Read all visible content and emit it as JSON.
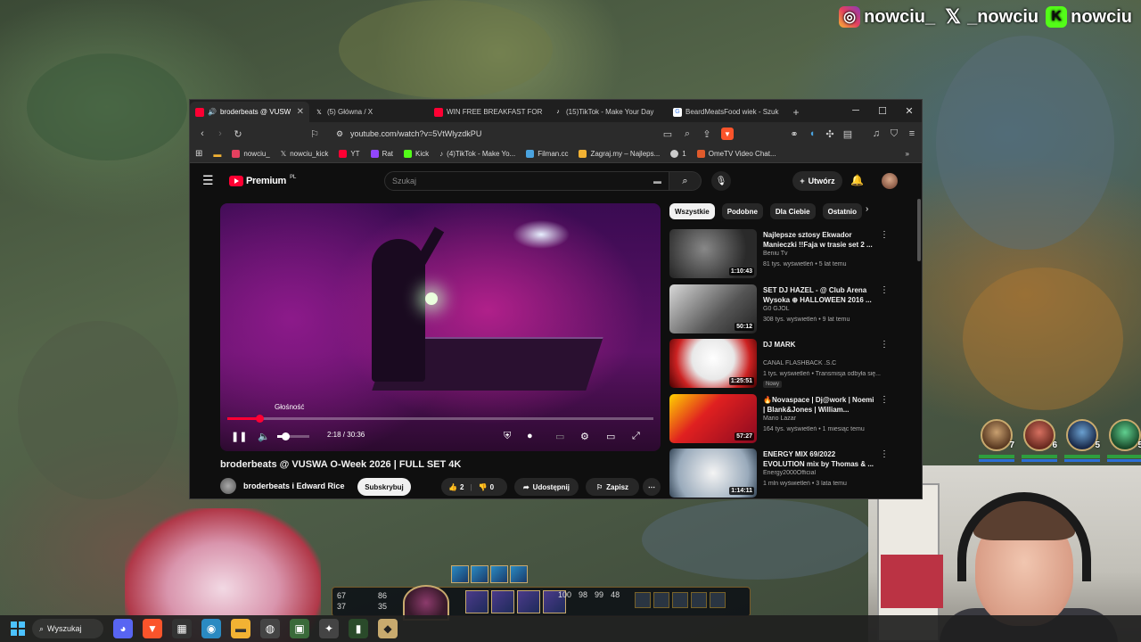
{
  "overlay": {
    "socials": [
      {
        "icon": "instagram-icon",
        "handle": "nowciu_"
      },
      {
        "icon": "x-icon",
        "handle": "_nowciu"
      },
      {
        "icon": "kick-icon",
        "handle": "nowciu"
      }
    ],
    "party_levels": [
      "7",
      "6",
      "5",
      "5"
    ]
  },
  "browser": {
    "tabs": [
      {
        "title": "broderbeats @ VUSW",
        "icon": "youtube-icon",
        "active": true
      },
      {
        "title": "(5) Główna / X",
        "icon": "x-icon"
      },
      {
        "title": "WIN FREE BREAKFAST FOR A",
        "icon": "youtube-icon"
      },
      {
        "title": "(15)TikTok - Make Your Day",
        "icon": "tiktok-icon"
      },
      {
        "title": "BeardMeatsFood wiek - Szuk",
        "icon": "google-icon"
      }
    ],
    "url": "youtube.com/watch?v=5VtWlyzdkPU",
    "bookmarks": [
      {
        "label": "nowciu_",
        "color": "#e4405f"
      },
      {
        "label": "nowciu_kick",
        "color": "#ffffff"
      },
      {
        "label": "YT",
        "color": "#ff0033"
      },
      {
        "label": "Rat",
        "color": "#9146ff"
      },
      {
        "label": "Kick",
        "color": "#53fc18"
      },
      {
        "label": "(4)TikTok - Make Yo...",
        "color": "#ffffff"
      },
      {
        "label": "Filman.cc",
        "color": "#4aa3df"
      },
      {
        "label": "Zagraj.my – Najleps...",
        "color": "#f2b233"
      },
      {
        "label": "1",
        "color": "#cccccc"
      },
      {
        "label": "OmeTV Video Chat...",
        "color": "#e05a2b"
      }
    ]
  },
  "youtube": {
    "logo": "Premium",
    "logo_region": "PL",
    "search_placeholder": "Szukaj",
    "create_label": "Utwórz",
    "player": {
      "volume_tooltip": "Głośność",
      "current_time": "2:18",
      "duration": "30:36",
      "time_display": "2:18 / 30:36",
      "progress_fraction": 0.075,
      "volume_fraction": 0.25
    },
    "video_title": "broderbeats @ VUSWA O-Week 2026 | FULL SET 4K",
    "channel": "broderbeats i Edward Rice",
    "subscribe_label": "Subskrybuj",
    "likes": "2",
    "dislikes": "0",
    "share_label": "Udostępnij",
    "save_label": "Zapisz",
    "chips": [
      "Wszystkie",
      "Podobne",
      "Dla Ciebie",
      "Ostatnio"
    ],
    "recommendations": [
      {
        "title": "Najlepsze sztosy Ekwador Manieczki !!Faja w trasie set 2 ...",
        "channel": "Beniu Tv",
        "meta": "81 tys. wyświetleń • 5 lat temu",
        "duration": "1:10:43",
        "badge": ""
      },
      {
        "title": "SET DJ HAZEL - @ Club Arena Wysoka ⊕ HALLOWEEN 2016 ...",
        "channel": "G0 GJOL",
        "meta": "308 tys. wyświetleń • 9 lat temu",
        "duration": "50:12",
        "badge": ""
      },
      {
        "title": "DJ MARK",
        "channel": "CANAL FLASHBACK .S.C",
        "meta": "1 tys. wyświetleń • Transmisja odbyła się...",
        "duration": "1:25:51",
        "badge": "Nowy"
      },
      {
        "title": "🔥Novaspace | Dj@work | Noemi | Blank&Jones | William...",
        "channel": "Mario Lazar",
        "meta": "164 tys. wyświetleń • 1 miesiąc temu",
        "duration": "57:27",
        "badge": ""
      },
      {
        "title": "ENERGY MIX 69/2022 EVOLUTION mix by Thomas & ...",
        "channel": "Energy2000Official",
        "meta": "1 mln wyświetleń • 3 lata temu",
        "duration": "1:14:11",
        "badge": ""
      }
    ]
  },
  "hud": {
    "stats_left": [
      "67",
      "37"
    ],
    "stats_mid": [
      "86",
      "35"
    ],
    "stats_right": [
      "98",
      "99",
      "48"
    ],
    "level": "100"
  },
  "taskbar": {
    "search_label": "Wyszukaj"
  }
}
